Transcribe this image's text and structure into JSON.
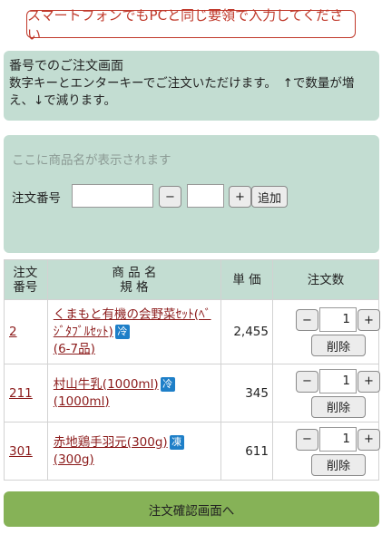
{
  "notice": "スマートフォンでもPCと同じ要領で入力してください",
  "info": {
    "title": "番号でのご注文画面",
    "text": "数字キーとエンターキーでご注文いただけます。　↑で数量が増え、↓で減ります。"
  },
  "entry": {
    "placeholder": "ここに商品名が表示されます",
    "order_label": "注文番号",
    "minus": "−",
    "plus": "+",
    "add": "追加"
  },
  "table": {
    "headers": {
      "no_line1": "注文",
      "no_line2": "番号",
      "name_line1": "商 品 名",
      "name_line2": "規 格",
      "price": "単 価",
      "qty": "注文数"
    },
    "rows": [
      {
        "no": "2",
        "name": "くまもと有機の会野菜ｾｯﾄ(ﾍﾞｼﾞﾀﾌﾞﾙｾｯﾄ)",
        "tag": "冷",
        "spec": "(6-7品)",
        "price": "2,455",
        "qty": "1"
      },
      {
        "no": "211",
        "name": "村山牛乳(1000ml)",
        "tag": "冷",
        "spec": "(1000ml)",
        "price": "345",
        "qty": "1"
      },
      {
        "no": "301",
        "name": "赤地鶏手羽元(300g)",
        "tag": "凍",
        "spec": "(300g)",
        "price": "611",
        "qty": "1"
      }
    ],
    "minus": "−",
    "plus": "+",
    "delete": "削除"
  },
  "confirm": "注文確認画面へ"
}
